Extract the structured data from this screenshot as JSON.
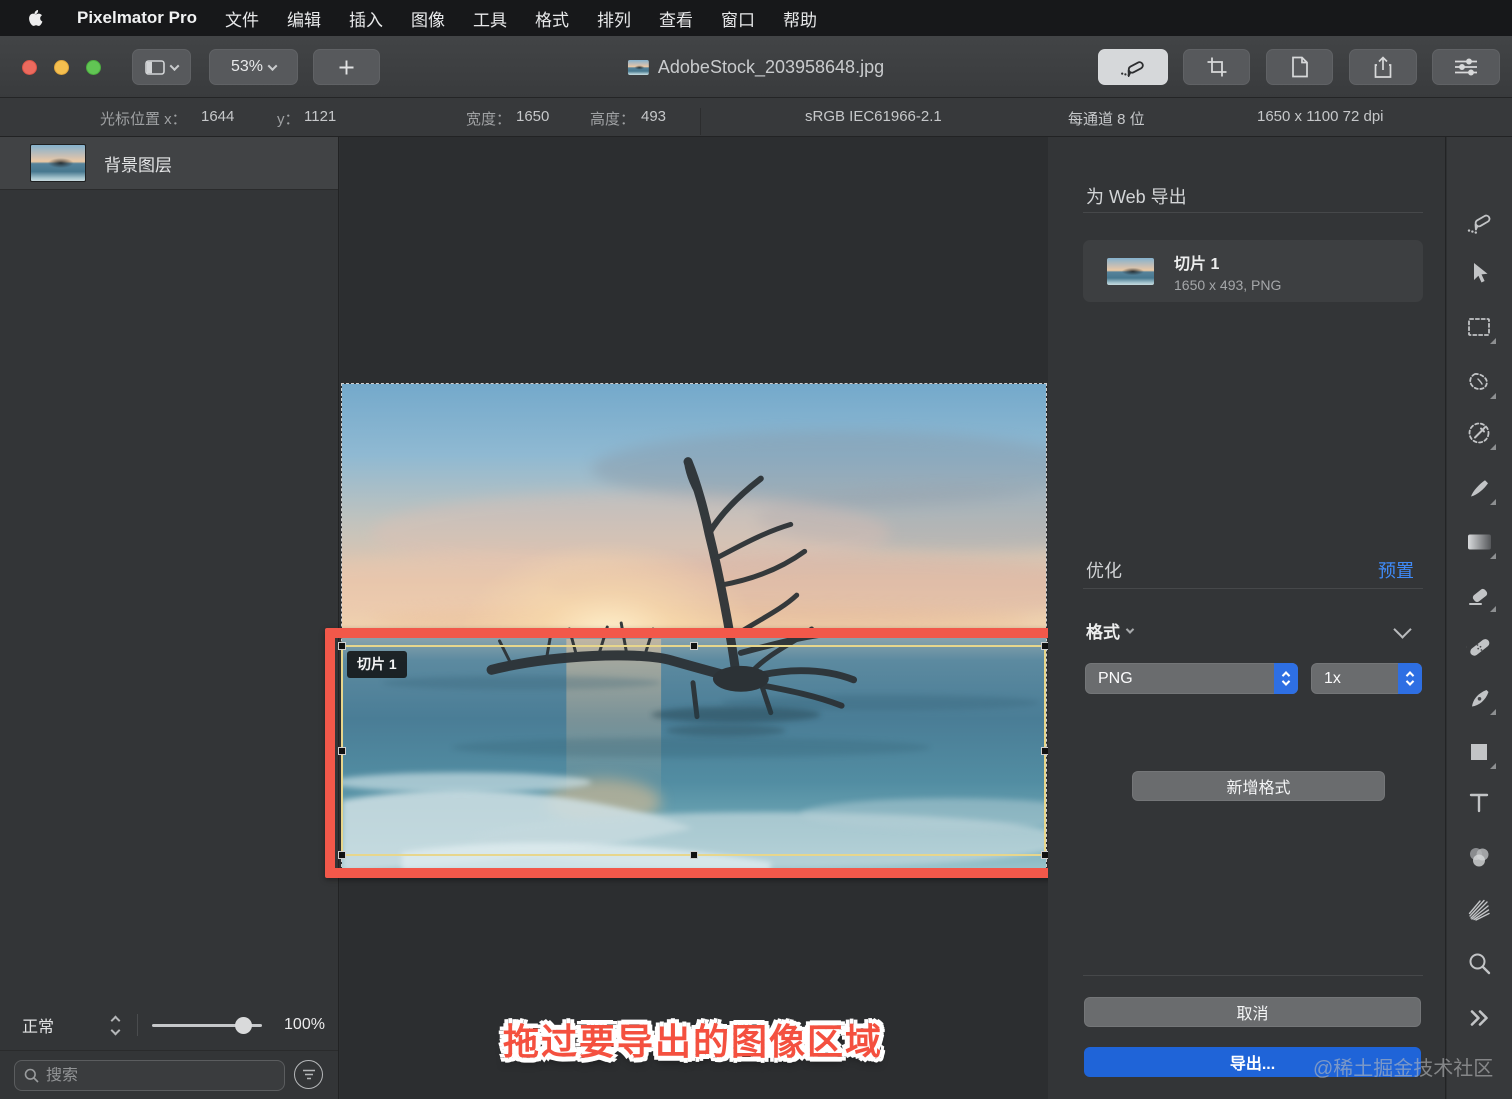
{
  "menu_bar": {
    "app_name": "Pixelmator Pro",
    "items": [
      "文件",
      "编辑",
      "插入",
      "图像",
      "工具",
      "格式",
      "排列",
      "查看",
      "窗口",
      "帮助"
    ]
  },
  "title_bar": {
    "zoom_level": "53%",
    "document_title": "AdobeStock_203958648.jpg"
  },
  "info_bar": {
    "cursor_label": "光标位置 x：",
    "cursor_x": "1644",
    "cursor_y_label": "y：",
    "cursor_y": "1121",
    "width_label": "宽度：",
    "width_value": "1650",
    "height_label": "高度：",
    "height_value": "493",
    "color_profile": "sRGB IEC61966-2.1",
    "channel_depth": "每通道 8 位",
    "dimensions": "1650 x 1100 72 dpi"
  },
  "layers_panel": {
    "layer_name": "背景图层",
    "blend_mode": "正常",
    "opacity": "100%",
    "search_placeholder": "搜索"
  },
  "canvas": {
    "slice_label": "切片 1",
    "caption": "拖过要导出的图像区域"
  },
  "export_panel": {
    "title": "为 Web 导出",
    "slice_name": "切片 1",
    "slice_meta": "1650 x 493, PNG",
    "optimize_label": "优化",
    "presets_label": "预置",
    "format_label": "格式",
    "format_value": "PNG",
    "scale_value": "1x",
    "add_format_label": "新增格式",
    "cancel_label": "取消",
    "export_label": "导出..."
  },
  "watermark": "@稀土掘金技术社区",
  "tools": [
    "slice",
    "arrange",
    "rect-select",
    "quick-select",
    "color-select",
    "paint",
    "gradient",
    "erase",
    "retouch",
    "pen",
    "shape",
    "type",
    "color-adjustments",
    "effects",
    "zoom",
    "more"
  ],
  "colors": {
    "accent_blue": "#2e6fe3",
    "export_blue": "#1f64d8",
    "link_blue": "#3f8af7",
    "annotation_red": "#f2584a",
    "slice_yellow": "#e7d68c"
  }
}
